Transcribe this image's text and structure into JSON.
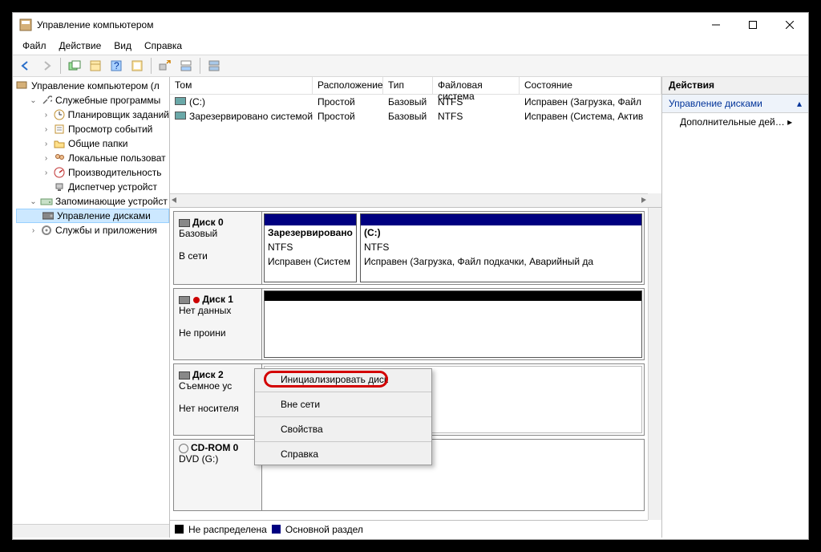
{
  "window": {
    "title": "Управление компьютером"
  },
  "menu": {
    "file": "Файл",
    "action": "Действие",
    "view": "Вид",
    "help": "Справка"
  },
  "tree": {
    "root": "Управление компьютером (л",
    "n1": "Служебные программы",
    "n1a": "Планировщик заданий",
    "n1b": "Просмотр событий",
    "n1c": "Общие папки",
    "n1d": "Локальные пользоват",
    "n1e": "Производительность",
    "n1f": "Диспетчер устройст",
    "n2": "Запоминающие устройст",
    "n2a": "Управление дисками",
    "n3": "Службы и приложения"
  },
  "cols": {
    "vol": "Том",
    "layout": "Расположение",
    "type": "Тип",
    "fs": "Файловая система",
    "status": "Состояние"
  },
  "vols": [
    {
      "name": "(C:)",
      "layout": "Простой",
      "type": "Базовый",
      "fs": "NTFS",
      "status": "Исправен (Загрузка, Файл"
    },
    {
      "name": "Зарезервировано системой",
      "layout": "Простой",
      "type": "Базовый",
      "fs": "NTFS",
      "status": "Исправен (Система, Актив"
    }
  ],
  "disk0": {
    "title": "Диск 0",
    "type": "Базовый",
    "status": "В сети",
    "p1": {
      "name": "Зарезервировано",
      "fs": "NTFS",
      "st": "Исправен (Систем"
    },
    "p2": {
      "name": "(C:)",
      "fs": "NTFS",
      "st": "Исправен (Загрузка, Файл подкачки, Аварийный да"
    }
  },
  "disk1": {
    "title": "Диск 1",
    "l2": "Нет данных",
    "l3": "Не проини"
  },
  "disk2": {
    "title": "Диск 2",
    "l2": "Съемное ус",
    "l3": "Нет носителя"
  },
  "cdrom": {
    "title": "CD-ROM 0",
    "l2": "DVD (G:)"
  },
  "legend": {
    "unalloc": "Не распределена",
    "primary": "Основной раздел"
  },
  "actions": {
    "title": "Действия",
    "sect": "Управление дисками",
    "more": "Дополнительные дей…"
  },
  "ctx": {
    "init": "Инициализировать диск",
    "offline": "Вне сети",
    "props": "Свойства",
    "help": "Справка"
  }
}
